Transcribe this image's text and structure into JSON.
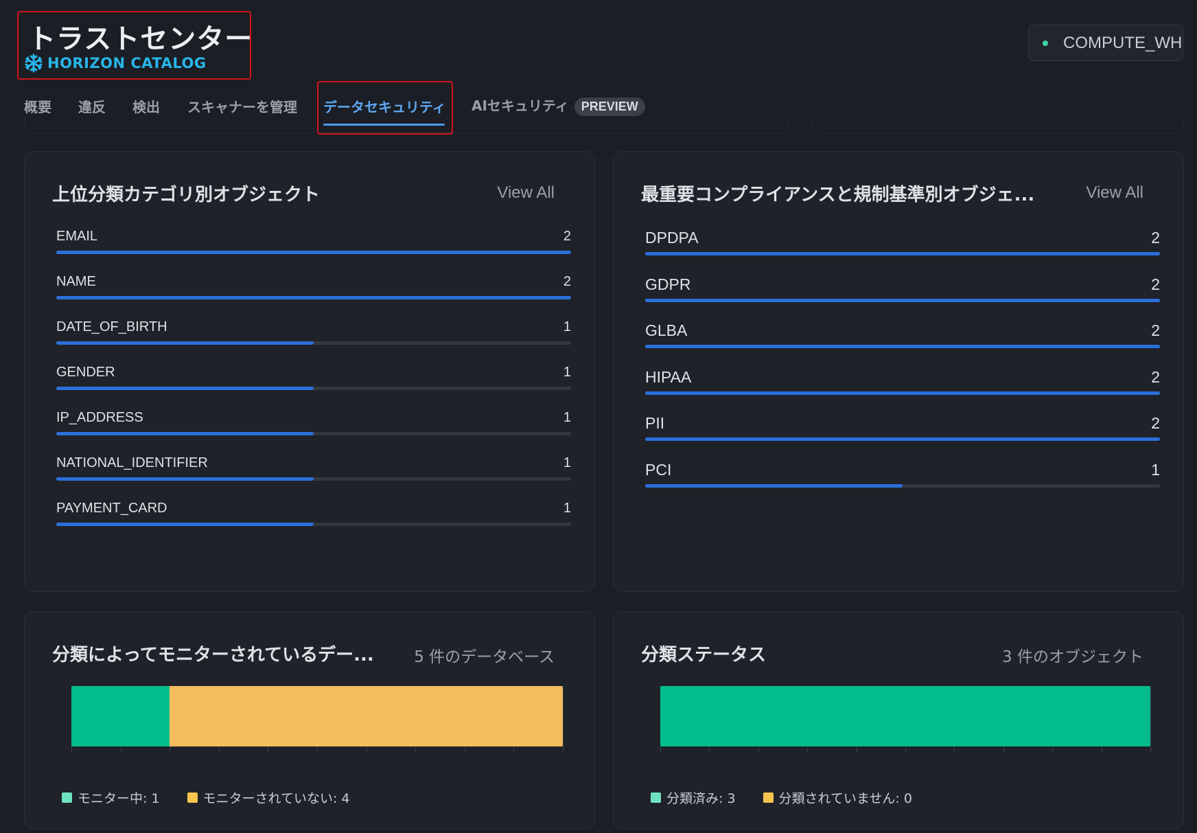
{
  "header": {
    "title": "トラストセンター",
    "brand": "HORIZON CATALOG",
    "warehouse": "COMPUTE_WH"
  },
  "tabs": [
    {
      "label": "概要"
    },
    {
      "label": "違反"
    },
    {
      "label": "検出"
    },
    {
      "label": "スキャナーを管理"
    },
    {
      "label": "データセキュリティ",
      "active": true
    },
    {
      "label": "AIセキュリティ",
      "badge": "PREVIEW"
    }
  ],
  "categories_card": {
    "title": "上位分類カテゴリ別オブジェクト",
    "action": "View All",
    "max": 2,
    "items": [
      {
        "label": "EMAIL",
        "count": "2",
        "value": 2
      },
      {
        "label": "NAME",
        "count": "2",
        "value": 2
      },
      {
        "label": "DATE_OF_BIRTH",
        "count": "1",
        "value": 1
      },
      {
        "label": "GENDER",
        "count": "1",
        "value": 1
      },
      {
        "label": "IP_ADDRESS",
        "count": "1",
        "value": 1
      },
      {
        "label": "NATIONAL_IDENTIFIER",
        "count": "1",
        "value": 1
      },
      {
        "label": "PAYMENT_CARD",
        "count": "1",
        "value": 1
      }
    ]
  },
  "compliance_card": {
    "title": "最重要コンプライアンスと規制基準別オブジェ...",
    "action": "View All",
    "max": 2,
    "items": [
      {
        "label": "DPDPA",
        "count": "2",
        "value": 2
      },
      {
        "label": "GDPR",
        "count": "2",
        "value": 2
      },
      {
        "label": "GLBA",
        "count": "2",
        "value": 2
      },
      {
        "label": "HIPAA",
        "count": "2",
        "value": 2
      },
      {
        "label": "PII",
        "count": "2",
        "value": 2
      },
      {
        "label": "PCI",
        "count": "1",
        "value": 1
      }
    ]
  },
  "monitor_card": {
    "title": "分類によってモニターされているデー...",
    "meta": "5 件のデータベース",
    "segments": [
      {
        "label": "モニター中: 1",
        "value": 1,
        "color": "#02bc8b",
        "swatch": "#6fe3c1"
      },
      {
        "label": "モニターされていない: 4",
        "value": 4,
        "color": "#f4bd5c",
        "swatch": "#f6c54e"
      }
    ]
  },
  "status_card": {
    "title": "分類ステータス",
    "meta": "3 件のオブジェクト",
    "segments": [
      {
        "label": "分類済み: 3",
        "value": 3,
        "color": "#02bc8b",
        "swatch": "#6fe3c1"
      },
      {
        "label": "分類されていません: 0",
        "value": 0,
        "color": "#f4bd5c",
        "swatch": "#f6c54e"
      }
    ]
  },
  "colors": {
    "accent": "#4b9bf0",
    "bar": "#2a6fdb",
    "highlight_box": "#d3151b",
    "brand": "#29b5e8"
  },
  "icons": {
    "brand": "snowflake-icon",
    "warehouse_status": "status-dot-icon"
  }
}
